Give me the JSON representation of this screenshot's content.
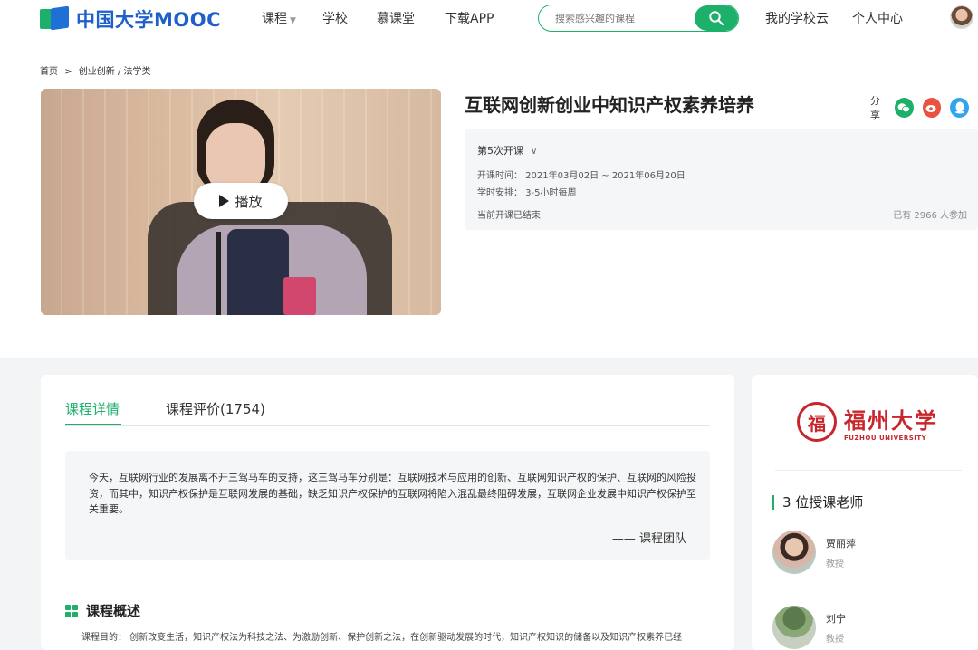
{
  "header": {
    "logo_text": "中国大学MOOC",
    "nav": {
      "courses": "课程",
      "school": "学校",
      "mooc_hall": "慕课堂",
      "download": "下载APP",
      "my_cloud": "我的学校云",
      "personal_center": "个人中心"
    },
    "search": {
      "placeholder": "搜索感兴趣的课程"
    },
    "accent_color": "#1db06b"
  },
  "breadcrumb": [
    "首页",
    ">",
    "创业创新 / 法学类"
  ],
  "video": {
    "play_label": "播放"
  },
  "course": {
    "title": "互联网创新创业中知识产权素养培养",
    "share_label": "分享",
    "share_icons": [
      "wechat-icon",
      "weibo-icon",
      "qq-icon"
    ],
    "session_label": "第5次开课",
    "time": "开课时间：  2021年03月02日 ~ 2021年06月20日",
    "hours": "学时安排：  3-5小时每周",
    "status": "当前开课已结束",
    "count": "已有 2966 人参加"
  },
  "tabs": {
    "detail": "课程详情",
    "review": "课程评价(1754)"
  },
  "quote": {
    "text": "今天，互联网行业的发展离不开三驾马车的支持，这三驾马车分别是：互联网技术与应用的创新、互联网知识产权的保护、互联网的风险投资，而其中，知识产权保护是互联网发展的基础，缺乏知识产权保护的互联网将陷入混乱最终阻碍发展，互联网企业发展中知识产权保护至关重要。",
    "author": "—— 课程团队"
  },
  "overview": {
    "title": "课程概述",
    "text": "课程目的： 创新改变生活，知识产权法为科技之法、为激励创新、保护创新之法，在创新驱动发展的时代，知识产权知识的储备以及知识产权素养已经"
  },
  "university": {
    "name_cn": "福州大学",
    "name_en": "FUZHOU UNIVERSITY",
    "seal_char": "福"
  },
  "teachers": {
    "title": "3 位授课老师",
    "list": [
      {
        "name": "贾丽萍",
        "role": "教授"
      },
      {
        "name": "刘宁",
        "role": "教授"
      }
    ]
  }
}
